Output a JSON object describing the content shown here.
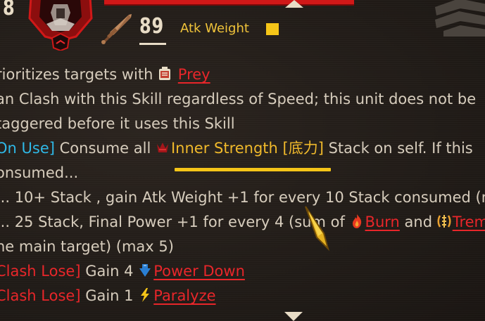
{
  "header": {
    "level_digit": "8",
    "atk_value": "89",
    "atk_weight_label": "Atk Weight",
    "atk_weight_pips": 1,
    "bar_color": "#d01818",
    "accent_color": "#f5c518"
  },
  "description": {
    "line1": {
      "text": "rioritizes targets with ",
      "keyword": "Prey"
    },
    "line2": "an Clash with this Skill regardless of Speed; this unit does not be",
    "line3": "taggered before it uses this Skill",
    "line4": {
      "tag": "On Use]",
      "text_before": " Consume all ",
      "keyword": "Inner Strength [底力]",
      "text_after": " Stack on self. If this"
    },
    "line5": "onsumed...",
    "line6": "... 10+ Stack , gain Atk Weight +1 for every 10 Stack consumed (m",
    "line7": {
      "text": "... 25 Stack, Final Power +1 for every 4 (sum of ",
      "keyword1": "Burn",
      "conj": " and ",
      "keyword2": "Trem"
    },
    "line8": "he main target) (max 5)",
    "line9": {
      "tag": "Clash Lose]",
      "text": " Gain 4 ",
      "keyword": "Power Down"
    },
    "line10": {
      "tag": "Clash Lose]",
      "text": " Gain 1 ",
      "keyword": "Paralyze"
    }
  },
  "icons": {
    "portrait": "character-portrait-icon",
    "sword": "sword-icon",
    "prey": "prey-icon",
    "inner_strength": "inner-strength-icon",
    "burn": "burn-icon",
    "tremor": "tremor-icon",
    "power_down": "power-down-icon",
    "paralyze": "paralyze-icon",
    "cursor": "pointer-cursor-icon",
    "emblem": "emblem-icon"
  }
}
